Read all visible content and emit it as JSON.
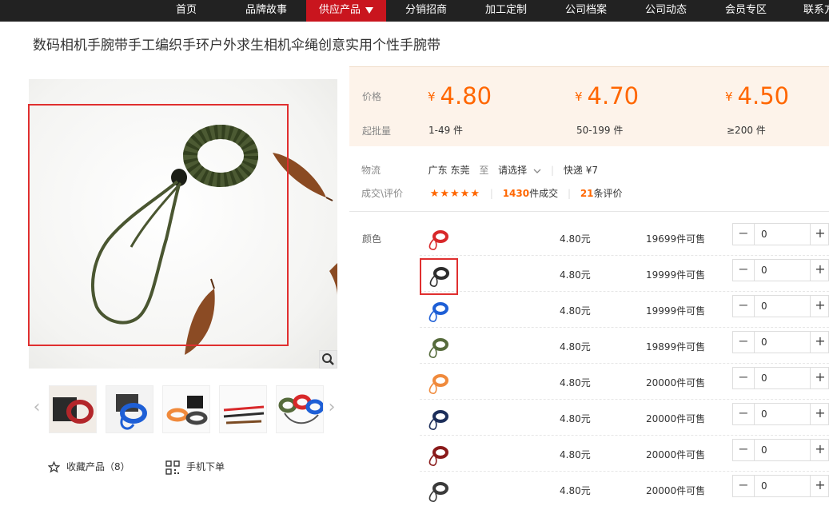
{
  "nav": {
    "items": [
      {
        "label": "首页"
      },
      {
        "label": "品牌故事"
      },
      {
        "label": "供应产品"
      },
      {
        "label": "分销招商"
      },
      {
        "label": "加工定制"
      },
      {
        "label": "公司档案"
      },
      {
        "label": "公司动态"
      },
      {
        "label": "会员专区"
      },
      {
        "label": "联系方"
      }
    ],
    "active_color": "#c9151e"
  },
  "product": {
    "title": "数码相机手腕带手工编织手环户外求生相机伞绳创意实用个性手腕带"
  },
  "gallery": {
    "thumbnail_count": 5,
    "zoom_icon": "magnifier-icon",
    "prev_icon": "chevron-left-icon",
    "next_icon": "chevron-right-icon"
  },
  "actions": {
    "favorite_label": "收藏产品（8）",
    "favorite_icon": "star-outline-icon",
    "mobile_label": "手机下单",
    "mobile_icon": "qr-code-icon"
  },
  "pricing": {
    "price_label": "价格",
    "moq_label": "起批量",
    "currency": "¥",
    "tiers": [
      {
        "price": "4.80",
        "range": "1-49 件"
      },
      {
        "price": "4.70",
        "range": "50-199 件"
      },
      {
        "price": "4.50",
        "range": "≥200 件"
      }
    ],
    "accent_color": "#ff6600"
  },
  "logistics": {
    "label": "物流",
    "from": "广东 东莞",
    "to_word": "至",
    "destination": "请选择",
    "shipping": "快递 ¥7"
  },
  "deals": {
    "label": "成交\\评价",
    "stars": "★★★★★",
    "count": "1430",
    "count_suffix": "件成交",
    "reviews": "21",
    "reviews_suffix": "条评价"
  },
  "sku": {
    "label": "颜色",
    "rows": [
      {
        "price": "4.80元",
        "stock": "19699件可售",
        "qty": "0",
        "color": "#d8282a",
        "selected": false
      },
      {
        "price": "4.80元",
        "stock": "19999件可售",
        "qty": "0",
        "color": "#2c2c2c",
        "selected": true
      },
      {
        "price": "4.80元",
        "stock": "19999件可售",
        "qty": "0",
        "color": "#1e5fd6",
        "selected": false
      },
      {
        "price": "4.80元",
        "stock": "19899件可售",
        "qty": "0",
        "color": "#566b3c",
        "selected": false
      },
      {
        "price": "4.80元",
        "stock": "20000件可售",
        "qty": "0",
        "color": "#f08a3c",
        "selected": false
      },
      {
        "price": "4.80元",
        "stock": "20000件可售",
        "qty": "0",
        "color": "#1c2e5a",
        "selected": false
      },
      {
        "price": "4.80元",
        "stock": "20000件可售",
        "qty": "0",
        "color": "#8a1a1a",
        "selected": false
      },
      {
        "price": "4.80元",
        "stock": "20000件可售",
        "qty": "0",
        "color": "#3a3a3a",
        "selected": false
      }
    ],
    "minus_symbol": "−",
    "plus_symbol": "+"
  }
}
